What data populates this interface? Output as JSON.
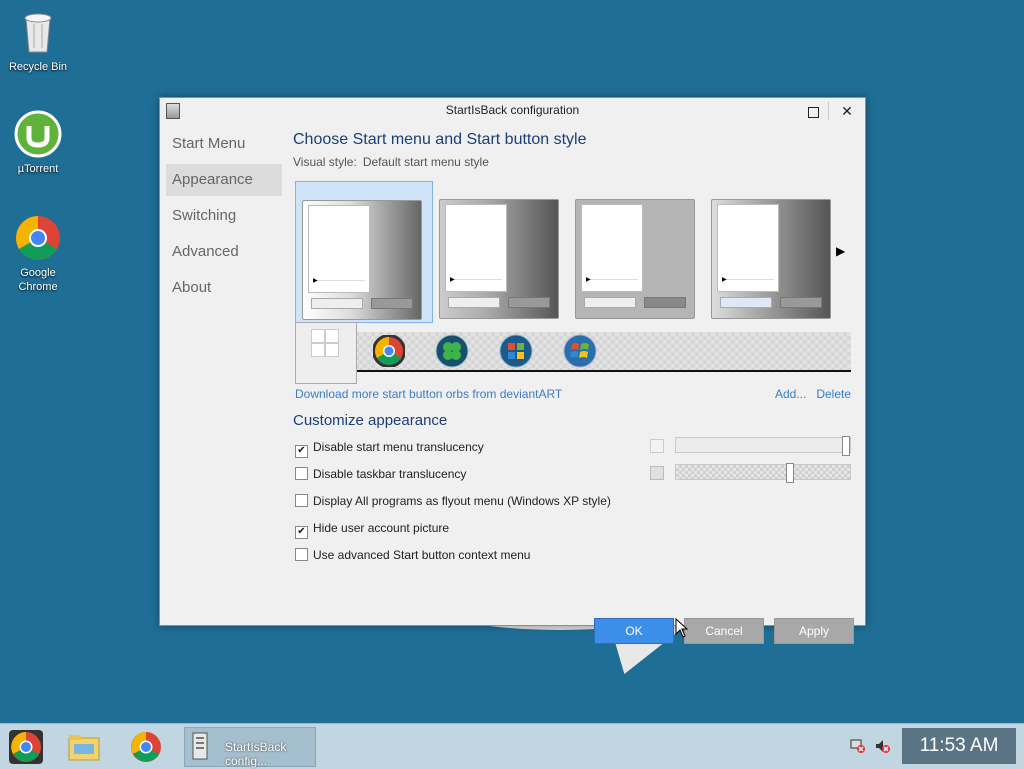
{
  "desktop": {
    "icons": [
      {
        "label": "Recycle Bin",
        "icon": "recycle-bin-icon"
      },
      {
        "label": "µTorrent",
        "icon": "utorrent-icon"
      },
      {
        "label": "Google Chrome",
        "icon": "chrome-icon"
      }
    ]
  },
  "window": {
    "title": "StartIsBack configuration",
    "controls": {
      "maximize": "maximize-icon",
      "close": "✕"
    }
  },
  "nav": {
    "items": [
      {
        "label": "Start Menu"
      },
      {
        "label": "Appearance",
        "active": true
      },
      {
        "label": "Switching"
      },
      {
        "label": "Advanced"
      },
      {
        "label": "About"
      }
    ]
  },
  "content": {
    "heading": "Choose Start menu and Start button style",
    "visual_style_label": "Visual style:",
    "visual_style_value": "Default start menu style",
    "styles_selected_index": 0,
    "download_link": "Download more start button orbs from deviantART",
    "add_link": "Add...",
    "delete_link": "Delete",
    "customize_heading": "Customize appearance",
    "options": [
      {
        "label": "Disable start menu translucency",
        "checked": true
      },
      {
        "label": "Disable taskbar translucency",
        "checked": false
      },
      {
        "label": "Display All programs as flyout menu (Windows XP style)",
        "checked": false
      },
      {
        "label": "Hide user account picture",
        "checked": true
      },
      {
        "label": "Use advanced Start button context menu",
        "checked": false
      }
    ],
    "slider_levels": [
      1.0,
      0.66
    ],
    "check_mark": "✔"
  },
  "buttons": {
    "ok": "OK",
    "cancel": "Cancel",
    "apply": "Apply"
  },
  "taskbar": {
    "task_label": "StartIsBack config...",
    "clock": "11:53 AM"
  },
  "colors": {
    "accent": "#3d8ee8",
    "desktop": "#1f6e96",
    "heading": "#1a3f7a"
  }
}
